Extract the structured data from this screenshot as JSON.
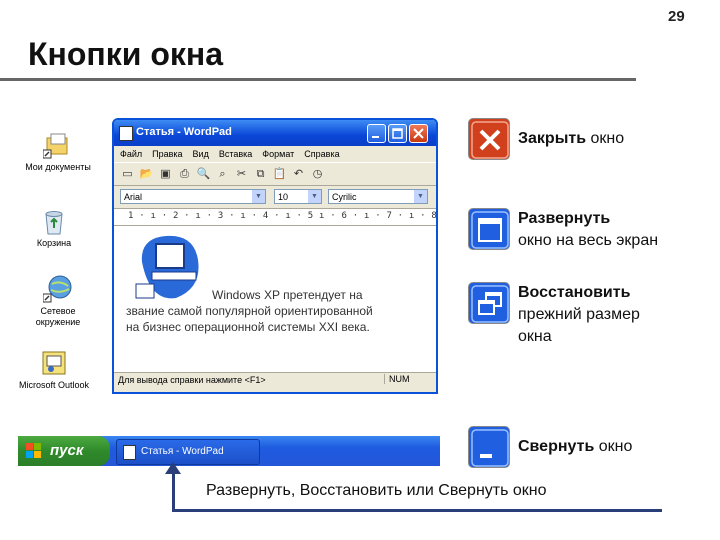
{
  "page_number": "29",
  "slide_title": "Кнопки окна",
  "desktop": {
    "icons": [
      {
        "label": "Мои документы",
        "icon": "my-documents-icon"
      },
      {
        "label": "Корзина",
        "icon": "recycle-bin-icon"
      },
      {
        "label": "Сетевое окружение",
        "icon": "network-icon"
      },
      {
        "label": "Microsoft Outlook",
        "icon": "outlook-icon"
      }
    ]
  },
  "wordpad": {
    "title": "Статья - WordPad",
    "menu": [
      "Файл",
      "Правка",
      "Вид",
      "Вставка",
      "Формат",
      "Справка"
    ],
    "font_name": "Arial",
    "font_size": "10",
    "script": "Cyrilic",
    "ruler": "1 · ı · 2 · ı · 3 · ı · 4 · ı · 5  ı · 6 · ı · 7 · ı · 8 · ı · 9",
    "doc_lines": [
      "Windows XP претендует на",
      "звание самой популярной ориентированной",
      "на бизнес операционной системы XXI века."
    ],
    "status_left": "Для вывода справки нажмите <F1>",
    "status_right": "NUM"
  },
  "taskbar": {
    "start_label": "пуск",
    "task_label": "Статья - WordPad"
  },
  "legend": {
    "close_strong": "Закрыть",
    "close_rest": " окно",
    "maximize_line1": "Развернуть",
    "maximize_line2": "окно на весь экран",
    "restore_line1": "Восстановить",
    "restore_line2": "прежний размер",
    "restore_line3": "окна",
    "minimize_strong": "Свернуть",
    "minimize_rest": " окно"
  },
  "caption": {
    "part1": "Развернуть",
    "part2": ", ",
    "part3": "Восстановить",
    "part4": " или ",
    "part5": "Свернуть",
    "part6": " окно"
  },
  "colors": {
    "title_blue": "#0a46d6",
    "close_red": "#d1401c",
    "start_green": "#2f8a2b"
  }
}
